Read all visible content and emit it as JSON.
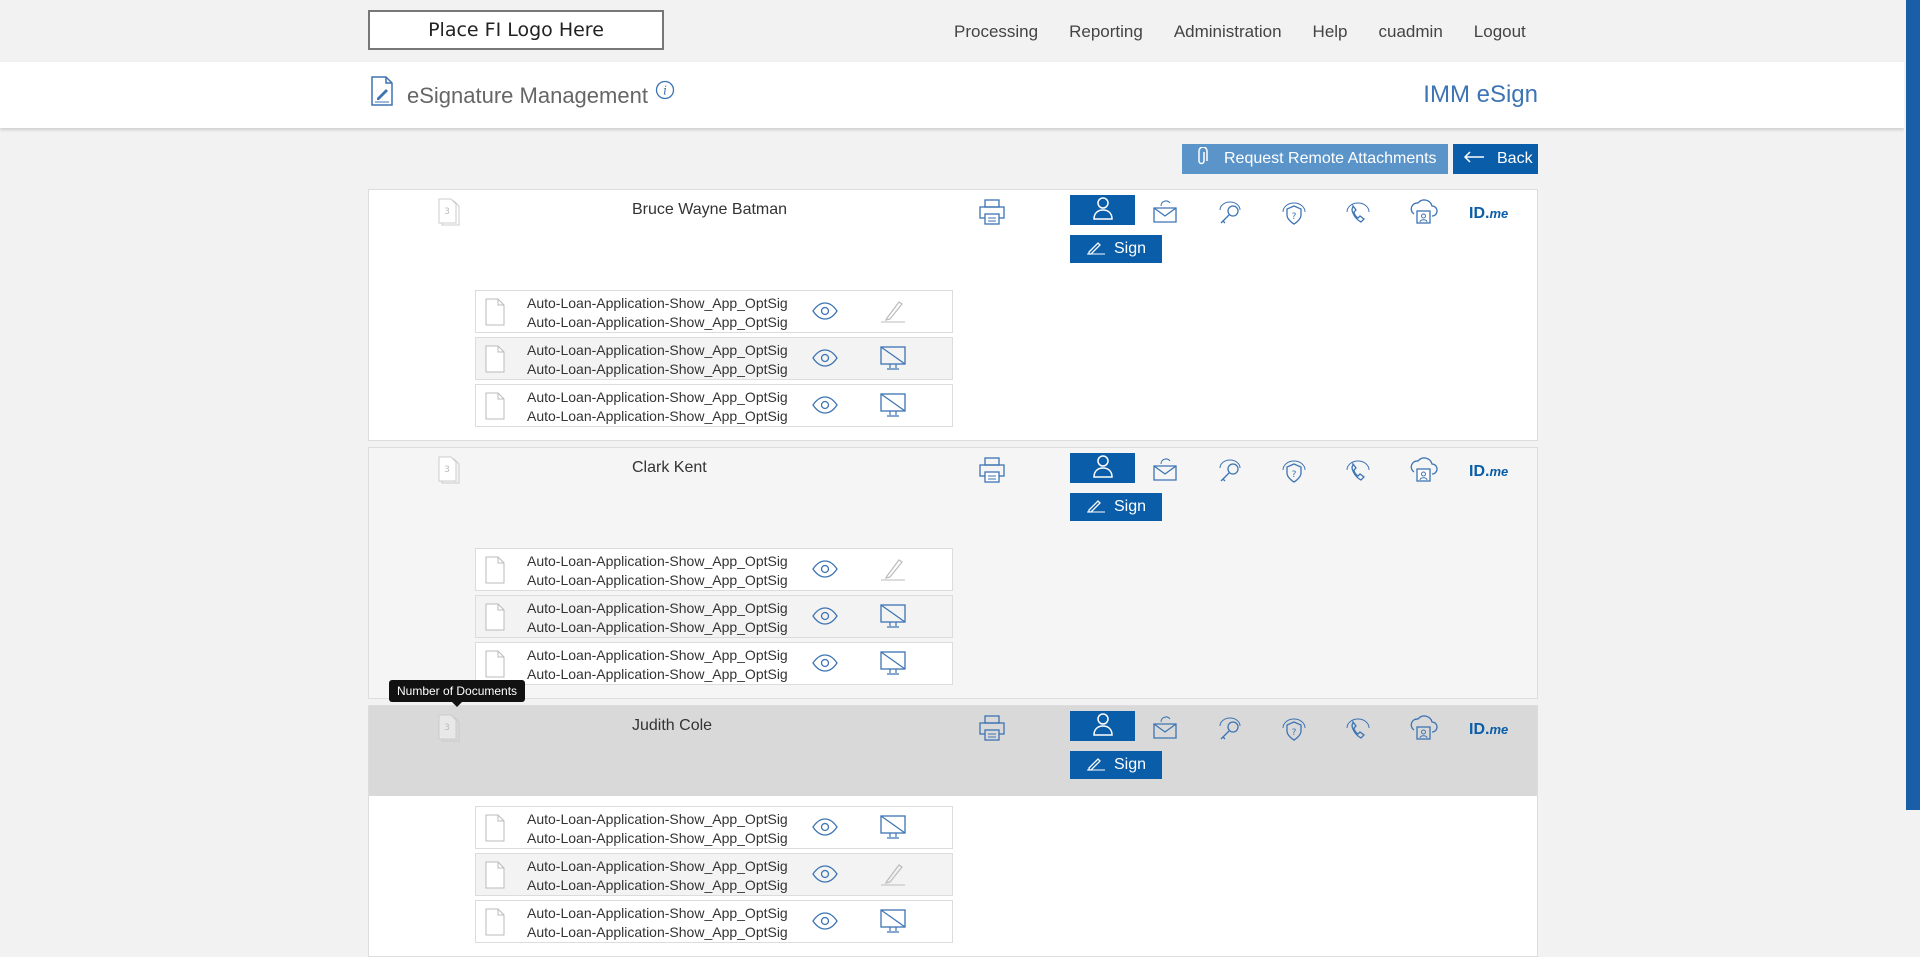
{
  "header": {
    "logo_text": "Place FI Logo Here",
    "nav": [
      "Processing",
      "Reporting",
      "Administration",
      "Help",
      "cuadmin",
      "Logout"
    ],
    "page_title": "eSignature Management",
    "app_name": "IMM eSign"
  },
  "actions": {
    "remote_attachments_label": "Request Remote Attachments",
    "back_label": "Back"
  },
  "idme_label": "ID.",
  "idme_suffix": "me",
  "sign_label": "Sign",
  "tooltip": "Number of Documents",
  "accent_color": "#0a5da8",
  "signers": [
    {
      "name": "Bruce Wayne Batman",
      "documents": [
        {
          "line1": "Auto-Loan-Application-Show_App_OptSig",
          "line2": "Auto-Loan-Application-Show_App_OptSig",
          "action": "sign-pen-icon"
        },
        {
          "line1": "Auto-Loan-Application-Show_App_OptSig",
          "line2": "Auto-Loan-Application-Show_App_OptSig",
          "action": "monitor-icon"
        },
        {
          "line1": "Auto-Loan-Application-Show_App_OptSig",
          "line2": "Auto-Loan-Application-Show_App_OptSig",
          "action": "monitor-icon"
        }
      ]
    },
    {
      "name": "Clark Kent",
      "documents": [
        {
          "line1": "Auto-Loan-Application-Show_App_OptSig",
          "line2": "Auto-Loan-Application-Show_App_OptSig",
          "action": "sign-pen-icon"
        },
        {
          "line1": "Auto-Loan-Application-Show_App_OptSig",
          "line2": "Auto-Loan-Application-Show_App_OptSig",
          "action": "monitor-icon"
        },
        {
          "line1": "Auto-Loan-Application-Show_App_OptSig",
          "line2": "Auto-Loan-Application-Show_App_OptSig",
          "action": "monitor-icon"
        }
      ]
    },
    {
      "name": "Judith Cole",
      "documents": [
        {
          "line1": "Auto-Loan-Application-Show_App_OptSig",
          "line2": "Auto-Loan-Application-Show_App_OptSig",
          "action": "monitor-icon"
        },
        {
          "line1": "Auto-Loan-Application-Show_App_OptSig",
          "line2": "Auto-Loan-Application-Show_App_OptSig",
          "action": "sign-pen-icon"
        },
        {
          "line1": "Auto-Loan-Application-Show_App_OptSig",
          "line2": "Auto-Loan-Application-Show_App_OptSig",
          "action": "monitor-icon"
        }
      ]
    }
  ]
}
